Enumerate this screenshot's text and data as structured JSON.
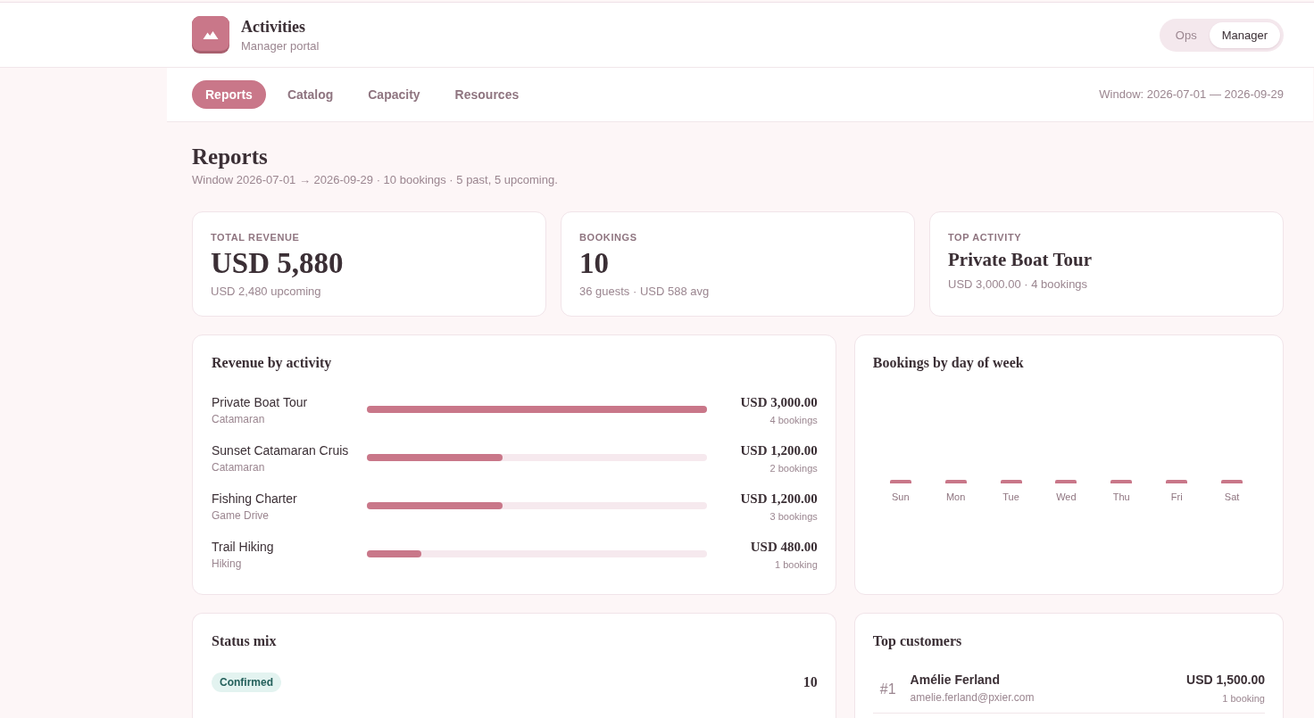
{
  "header": {
    "app_title": "Activities",
    "app_subtitle": "Manager portal",
    "role_toggle": [
      {
        "label": "Ops",
        "selected": false
      },
      {
        "label": "Manager",
        "selected": true
      }
    ]
  },
  "nav": {
    "tabs": [
      {
        "label": "Reports",
        "selected": true
      },
      {
        "label": "Catalog",
        "selected": false
      },
      {
        "label": "Capacity",
        "selected": false
      },
      {
        "label": "Resources",
        "selected": false
      }
    ],
    "window_label": "Window: 2026-07-01 — 2026-09-29"
  },
  "page": {
    "title": "Reports",
    "subtitle": "Window 2026-07-01 → 2026-09-29 · 10 bookings · 5 past, 5 upcoming."
  },
  "kpis": [
    {
      "kind": "figure",
      "label": "TOTAL REVENUE",
      "value": "USD 5,880",
      "note": "USD 2,480 upcoming"
    },
    {
      "kind": "figure",
      "label": "BOOKINGS",
      "value": "10",
      "note": "36 guests · USD 588 avg"
    },
    {
      "kind": "name",
      "label": "TOP ACTIVITY",
      "value": "Private Boat Tour",
      "note": "USD 3,000.00 · 4 bookings"
    }
  ],
  "revenue_by_activity": {
    "title": "Revenue by activity",
    "rows": [
      {
        "name": "Private Boat Tour",
        "category": "Catamaran",
        "level": 1,
        "amount": "USD 3,000.00",
        "bookings": "4 bookings"
      },
      {
        "name": "Sunset Catamaran Cruis",
        "category": "Catamaran",
        "level": 0.4,
        "amount": "USD 1,200.00",
        "bookings": "2 bookings"
      },
      {
        "name": "Fishing Charter",
        "category": "Game Drive",
        "level": 0.4,
        "amount": "USD 1,200.00",
        "bookings": "3 bookings"
      },
      {
        "name": "Trail Hiking",
        "category": "Hiking",
        "level": 0.16,
        "amount": "USD 480.00",
        "bookings": "1 booking"
      }
    ]
  },
  "bookings_by_day": {
    "title": "Bookings by day of week",
    "days": [
      "Sun",
      "Mon",
      "Tue",
      "Wed",
      "Thu",
      "Fri",
      "Sat"
    ]
  },
  "status_mix": {
    "title": "Status mix",
    "rows": [
      {
        "status": "Confirmed",
        "count": "10"
      }
    ]
  },
  "top_customers": {
    "title": "Top customers",
    "rows": [
      {
        "rank": "#1",
        "name": "Amélie Ferland",
        "email": "amelie.ferland@pxier.com",
        "amount": "USD 1,500.00",
        "bookings": "1 booking"
      }
    ]
  }
}
